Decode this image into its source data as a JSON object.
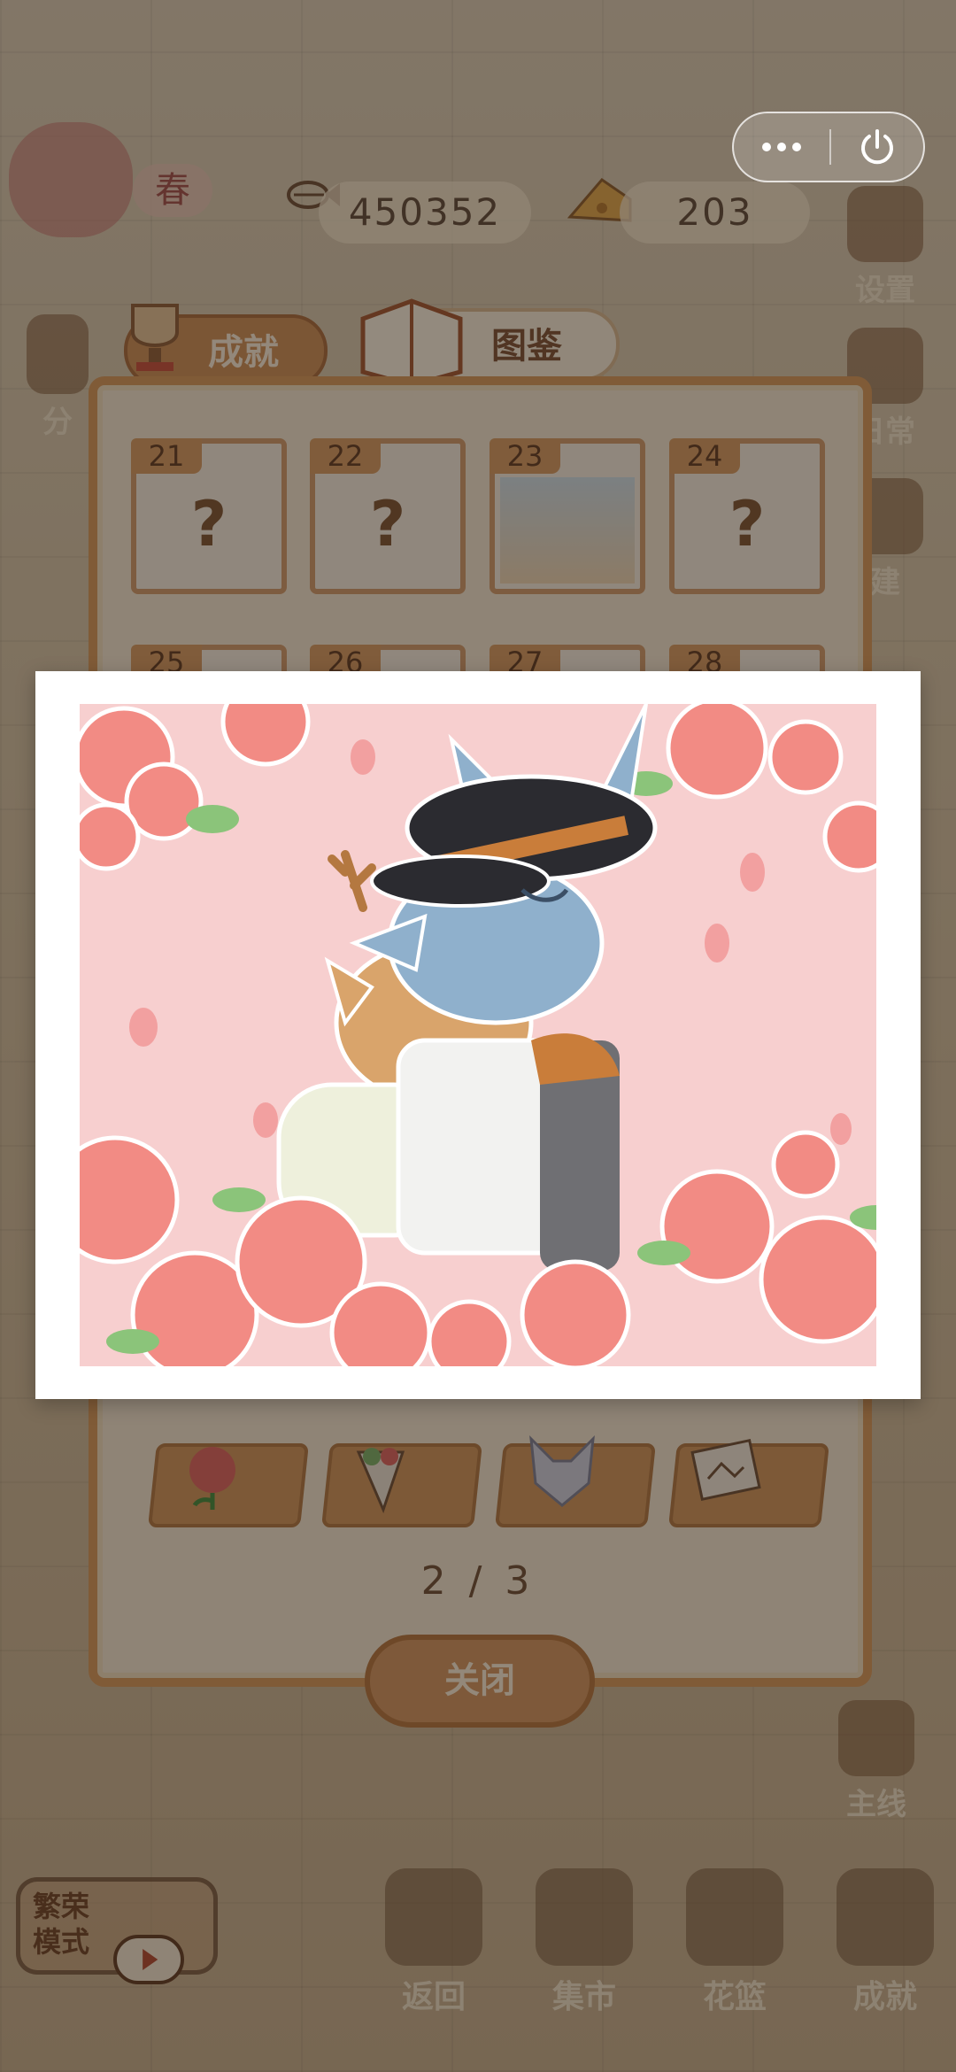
{
  "hud": {
    "season_label": "春",
    "fish_count": "450352",
    "cheese_count": "203"
  },
  "side_buttons": {
    "settings": "设置",
    "daily": "日常",
    "build": "建",
    "share_partial": "分",
    "mainline": "主线"
  },
  "dialog": {
    "tabs": [
      {
        "label": "成就"
      },
      {
        "label": "图鉴"
      }
    ],
    "cards": [
      {
        "number": "21",
        "mark": "?"
      },
      {
        "number": "22",
        "mark": "?"
      },
      {
        "number": "23",
        "mark": ""
      },
      {
        "number": "24",
        "mark": "?"
      },
      {
        "number": "25",
        "mark": ""
      },
      {
        "number": "26",
        "mark": ""
      },
      {
        "number": "27",
        "mark": ""
      },
      {
        "number": "28",
        "mark": ""
      }
    ],
    "items": [
      {
        "icon": "rose-icon"
      },
      {
        "icon": "bouquet-icon"
      },
      {
        "icon": "wolf-mask-icon"
      },
      {
        "icon": "photo-icon"
      }
    ],
    "pager": "2 / 3",
    "close_label": "关闭"
  },
  "popup": {
    "image": "deer-and-wolf-rose-illustration-icon",
    "colors": {
      "frame": "#ffffff",
      "background": "#f7cfcf",
      "rose": "#f28b84",
      "wolf": "#8fb0cc",
      "deer": "#d9a46b"
    }
  },
  "bottom_nav": {
    "mode_label_line1": "繁荣",
    "mode_label_line2": "模式",
    "items": [
      {
        "label": "返回"
      },
      {
        "label": "集市"
      },
      {
        "label": "花篮"
      },
      {
        "label": "成就"
      }
    ]
  }
}
